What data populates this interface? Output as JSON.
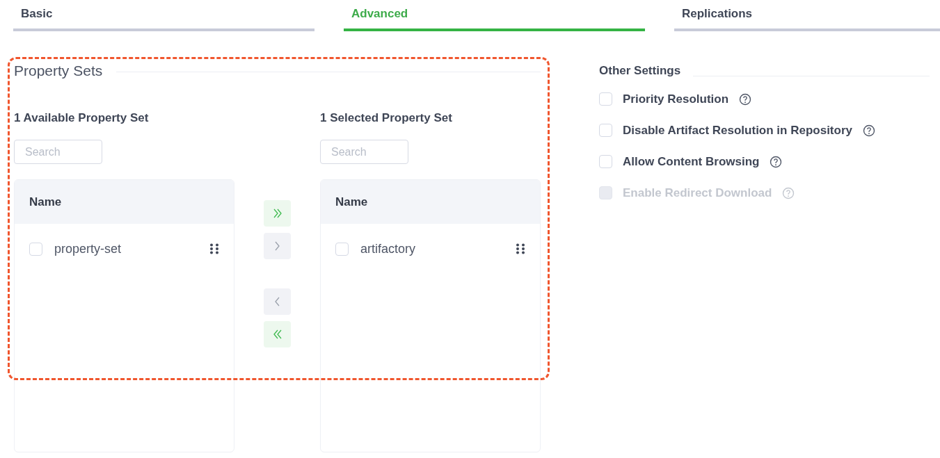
{
  "tabs": [
    {
      "label": "Basic",
      "selected": false
    },
    {
      "label": "Advanced",
      "selected": true
    },
    {
      "label": "Replications",
      "selected": false
    }
  ],
  "property_sets": {
    "title": "Property Sets",
    "available": {
      "heading": "1 Available Property Set",
      "search": {
        "placeholder": "Search"
      },
      "column": "Name",
      "rows": [
        {
          "name": "property-set",
          "checked": false
        }
      ]
    },
    "transfer_buttons": [
      {
        "kind": "add-all",
        "disabled": false
      },
      {
        "kind": "add",
        "disabled": true
      },
      {
        "kind": "remove",
        "disabled": true
      },
      {
        "kind": "remove-all",
        "disabled": false
      }
    ],
    "selected": {
      "heading": "1 Selected Property Set",
      "search": {
        "placeholder": "Search"
      },
      "column": "Name",
      "rows": [
        {
          "name": "artifactory",
          "checked": false
        }
      ]
    }
  },
  "other_settings": {
    "title": "Other Settings",
    "options": [
      {
        "label": "Priority Resolution",
        "checked": false,
        "disabled": false
      },
      {
        "label": "Disable Artifact Resolution in Repository",
        "checked": false,
        "disabled": false
      },
      {
        "label": "Allow Content Browsing",
        "checked": false,
        "disabled": false
      },
      {
        "label": "Enable Redirect Download",
        "checked": false,
        "disabled": true
      }
    ]
  }
}
